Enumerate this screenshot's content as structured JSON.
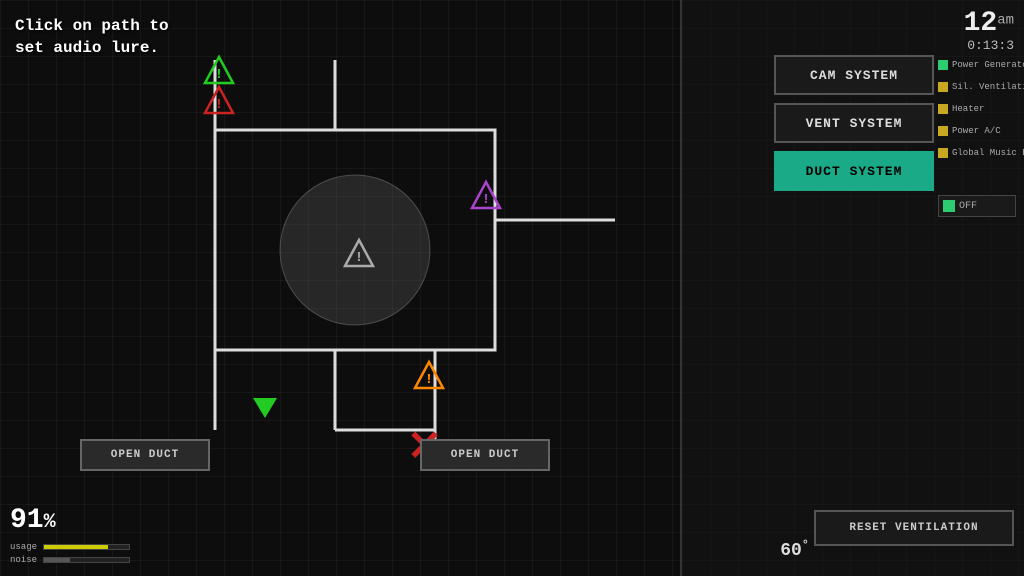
{
  "header": {
    "time_hour": "12",
    "time_ampm": "am",
    "time_counter": "0:13:3"
  },
  "instruction": {
    "line1": "Click on path to",
    "line2": "set audio lure."
  },
  "system_buttons": [
    {
      "id": "cam",
      "label": "CAM SYSTEM",
      "active": false
    },
    {
      "id": "vent",
      "label": "VENT SYSTEM",
      "active": false
    },
    {
      "id": "duct",
      "label": "DUCT SYSTEM",
      "active": true
    }
  ],
  "status_items": [
    {
      "id": "power-gen",
      "label": "Power Generator",
      "color": "green"
    },
    {
      "id": "sil-vent",
      "label": "Sil. Ventilation",
      "color": "yellow"
    },
    {
      "id": "heater",
      "label": "Heater",
      "color": "yellow"
    },
    {
      "id": "power-ac",
      "label": "Power A/C",
      "color": "yellow"
    },
    {
      "id": "global-music",
      "label": "Global Music Box",
      "color": "yellow"
    }
  ],
  "off_toggle": {
    "label": "OFF"
  },
  "open_duct_buttons": [
    {
      "id": "open-duct-left",
      "label": "OPEN DUCT"
    },
    {
      "id": "open-duct-right",
      "label": "OPEN DUCT"
    }
  ],
  "reset_button": {
    "label": "RESET VENTILATION"
  },
  "stats": {
    "percent": "91",
    "percent_sym": "%",
    "usage_label": "usage",
    "noise_label": "noise",
    "temperature": "60",
    "temp_sym": "°"
  }
}
